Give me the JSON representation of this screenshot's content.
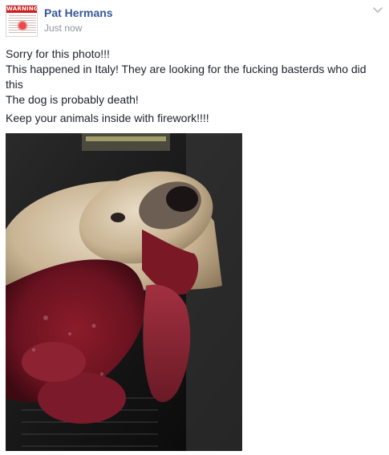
{
  "post": {
    "avatar_badge_text": "WARNING",
    "author_name": "Pat Hermans",
    "timestamp": "Just now",
    "menu_icon": "chevron-down-icon",
    "lines": [
      "Sorry for this photo!!!",
      "This happened in Italy! They are looking for the fucking basterds who did this",
      "The dog is probably death!",
      "Keep your animals inside with firework!!!!"
    ],
    "photo_subject": "injured-dog-photo"
  },
  "colors": {
    "author_link": "#365899",
    "timestamp": "#90949c",
    "body_text": "#1d2129",
    "avatar_banner": "#d11c1c"
  }
}
